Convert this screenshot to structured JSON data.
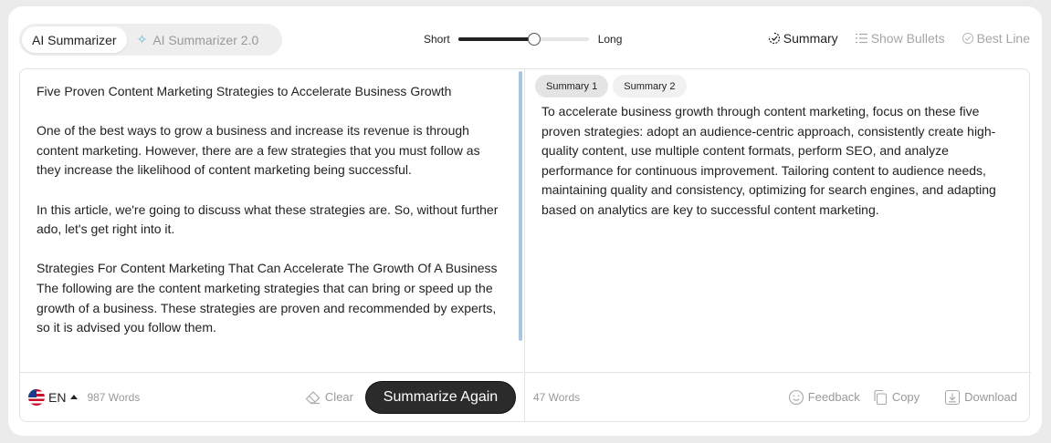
{
  "top": {
    "tabs": [
      {
        "label": "AI Summarizer",
        "active": true
      },
      {
        "label": "AI Summarizer 2.0",
        "active": false
      }
    ],
    "length": {
      "short_label": "Short",
      "long_label": "Long",
      "level": 0.58
    },
    "modes": [
      {
        "label": "Summary",
        "icon": "summary-icon",
        "active": true
      },
      {
        "label": "Show Bullets",
        "icon": "bullets-icon",
        "active": false
      },
      {
        "label": "Best Line",
        "icon": "best-line-icon",
        "active": false
      }
    ]
  },
  "input": {
    "paragraphs": [
      "Five Proven Content Marketing Strategies to Accelerate Business Growth",
      "",
      "One of the best ways to grow a business and increase its revenue is through content marketing. However, there are a few strategies that you must follow as they increase the likelihood of content marketing being successful.",
      "",
      "In this article, we're going to discuss what these strategies are. So, without further ado, let's get right into it.",
      "",
      "Strategies For Content Marketing That Can Accelerate The Growth Of A Business",
      "The following are the content marketing strategies that can bring or speed up the growth of a business. These strategies are proven and recommended by experts, so it is advised you follow them."
    ],
    "footer": {
      "language": "EN",
      "word_count": "987 Words",
      "clear_label": "Clear",
      "summarize_label": "Summarize Again"
    }
  },
  "output": {
    "tabs": [
      {
        "label": "Summary 1",
        "active": true
      },
      {
        "label": "Summary 2",
        "active": false
      }
    ],
    "text": "To accelerate business growth through content marketing, focus on these five proven strategies: adopt an audience-centric approach, consistently create high-quality content, use multiple content formats, perform SEO, and analyze performance for continuous improvement. Tailoring content to audience needs, maintaining quality and consistency, optimizing for search engines, and adapting based on analytics are key to successful content marketing.",
    "footer": {
      "word_count": "47 Words",
      "feedback_label": "Feedback",
      "copy_label": "Copy",
      "download_label": "Download"
    }
  },
  "colors": {
    "accent_dark": "#2b2b2b",
    "scrollbar": "#a8c6e4",
    "sparkle": "#63b8d6",
    "muted_text": "#999999"
  }
}
